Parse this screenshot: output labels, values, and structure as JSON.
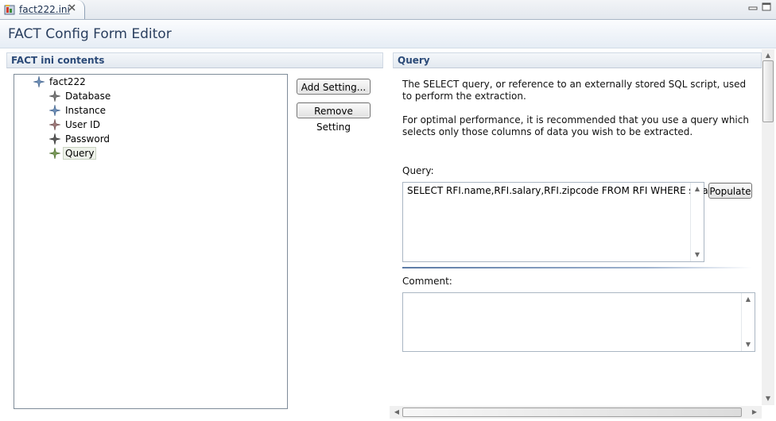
{
  "tab": {
    "label": "fact222.ini"
  },
  "editor": {
    "title": "FACT Config Form Editor"
  },
  "left_section": {
    "title": "FACT ini contents",
    "tree": {
      "root": "fact222",
      "children": [
        "Database",
        "Instance",
        "User ID",
        "Password",
        "Query"
      ],
      "selected": "Query"
    },
    "buttons": {
      "add": "Add Setting...",
      "remove": "Remove Setting"
    }
  },
  "right_section": {
    "title": "Query",
    "description1": "The SELECT query, or reference to an externally stored SQL script, used to perform the extraction.",
    "description2": "For optimal performance, it is recommended that you use a query which selects only those columns of data you wish to be extracted.",
    "query_label": "Query:",
    "query_value": "SELECT RFI.name,RFI.salary,RFI.zipcode FROM RFI WHERE salary",
    "populate_label": "Populate",
    "comment_label": "Comment:",
    "comment_value": ""
  },
  "colors": {
    "accent": "#2b4a78",
    "title": "#2a3f5f",
    "separator": "#5b7aa5"
  },
  "icons": {
    "tab": "fact-file-icon",
    "close": "close-icon",
    "minimize": "minimize-icon",
    "maximize": "maximize-icon",
    "tree_node": "sparkle-node-icon"
  }
}
